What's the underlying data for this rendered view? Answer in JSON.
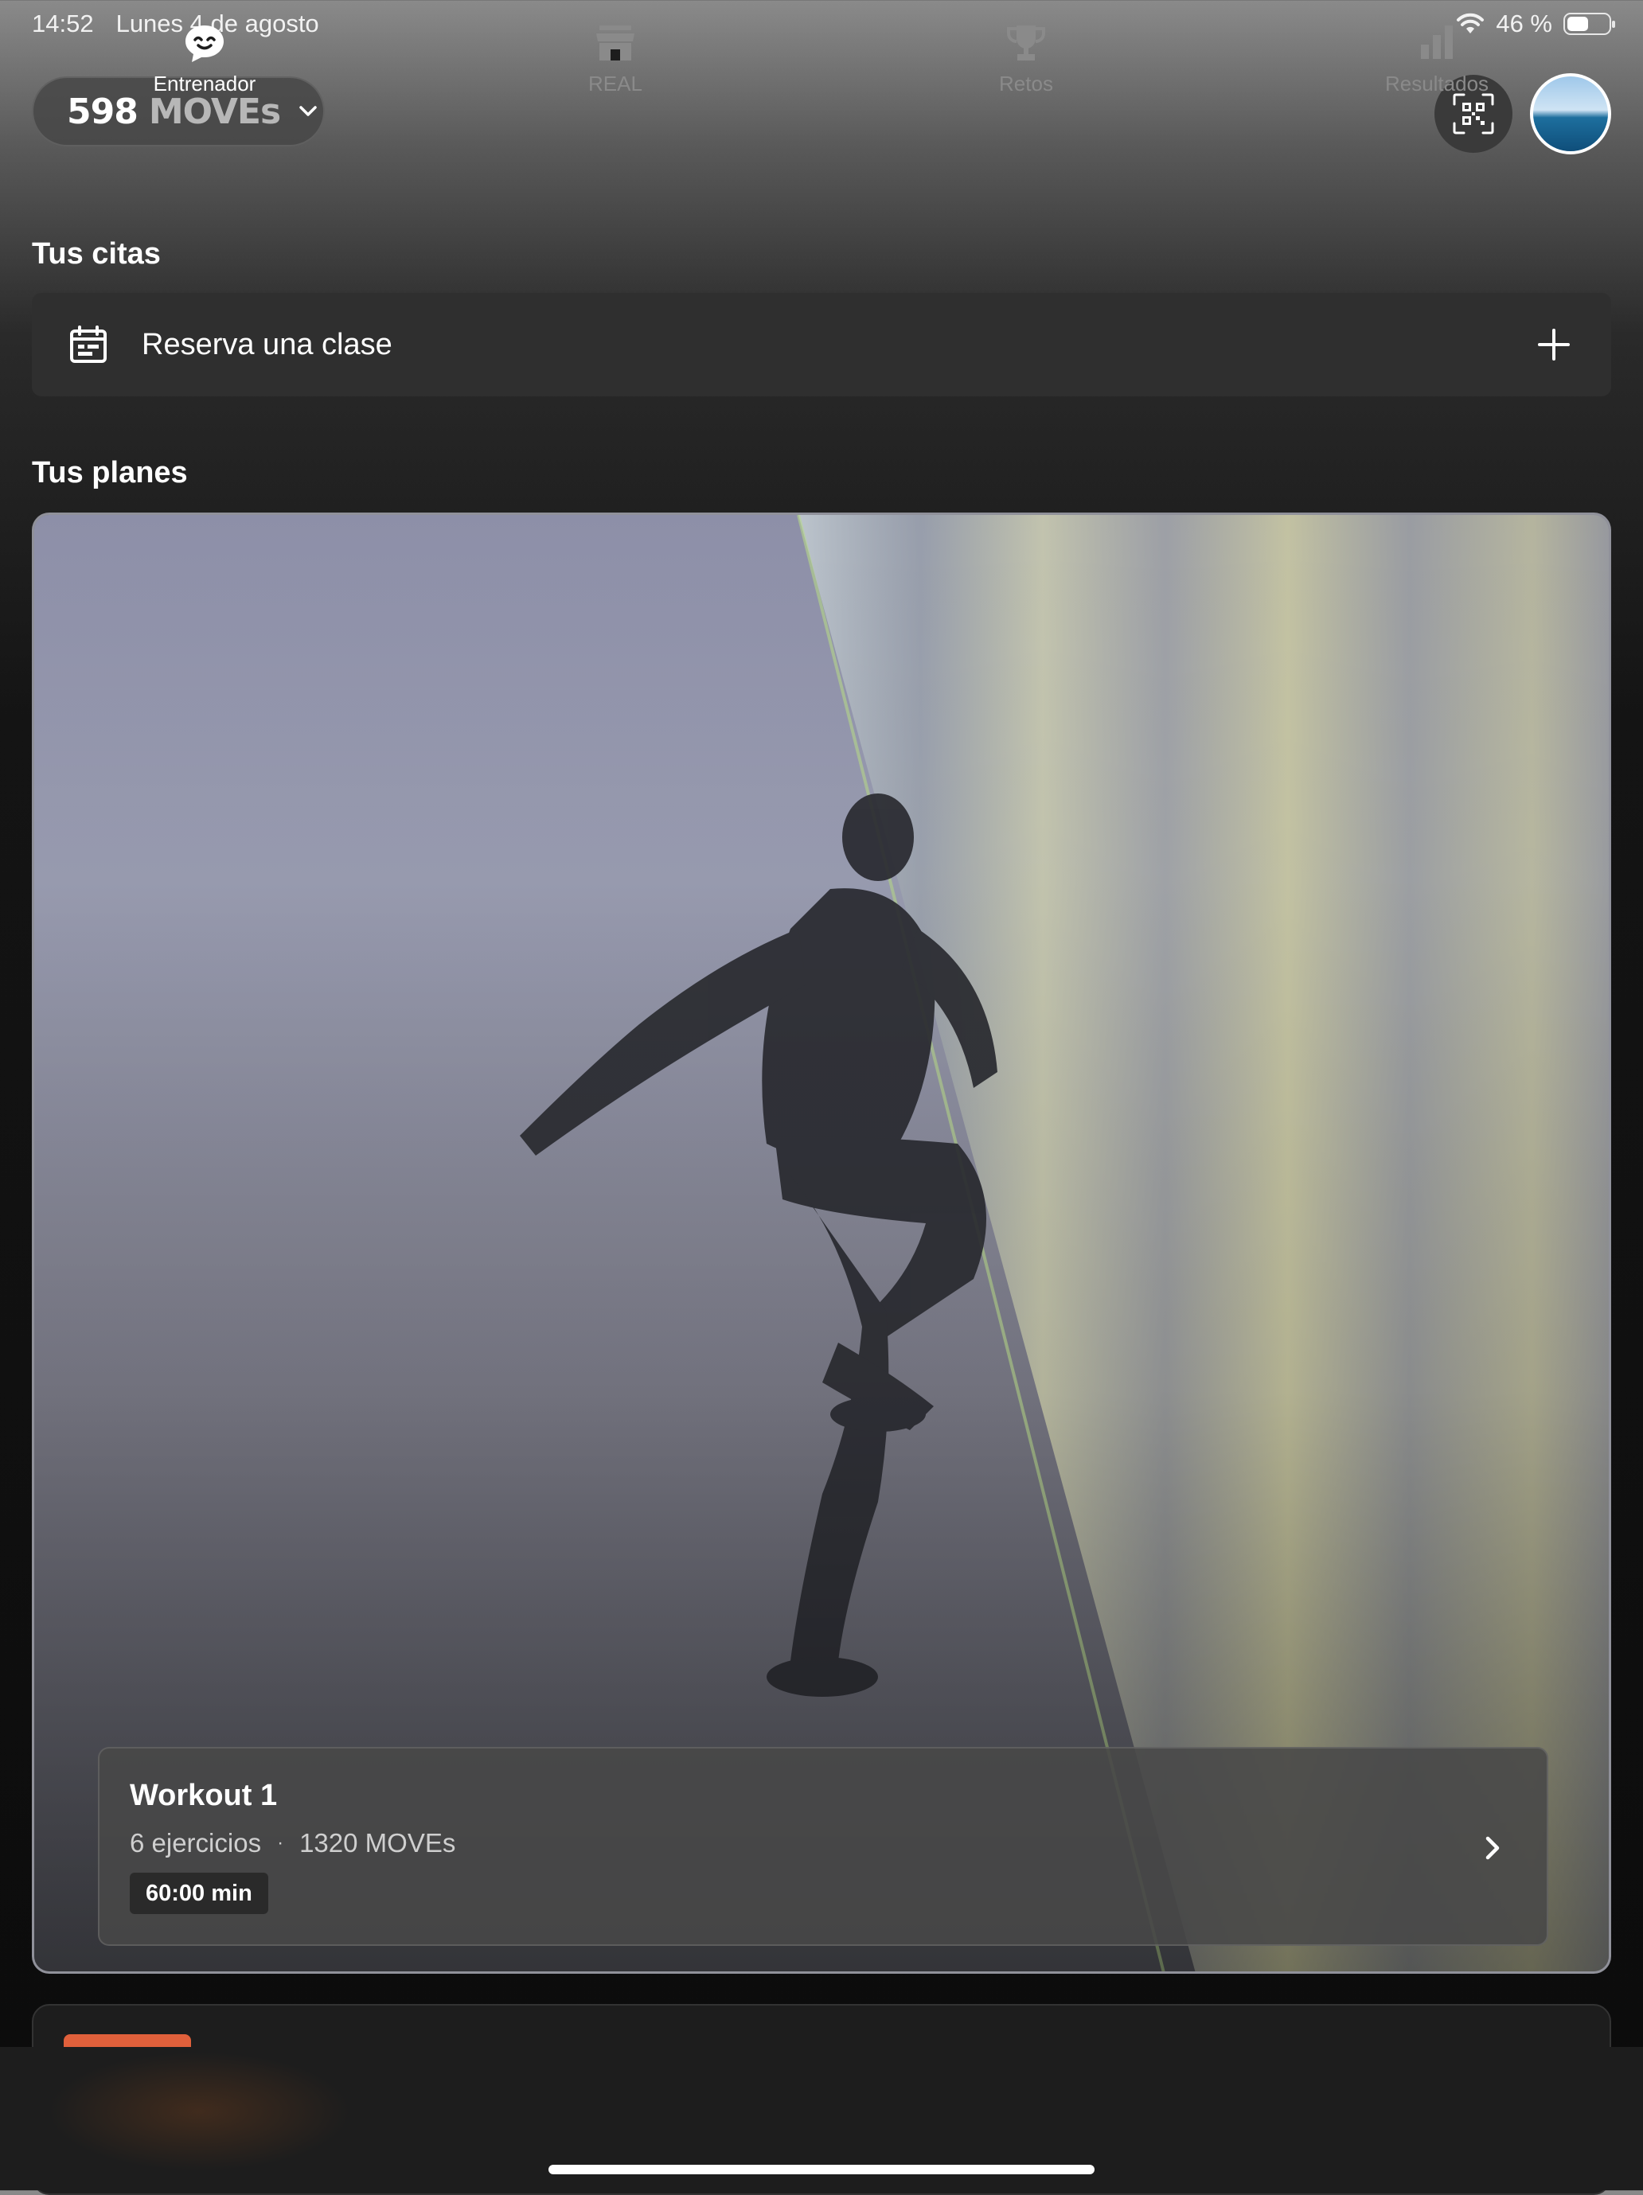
{
  "status_bar": {
    "time": "14:52",
    "date": "Lunes 4 de agosto",
    "battery_text": "46 %",
    "battery_level": 0.46,
    "icons": [
      "wifi-icon",
      "battery-icon"
    ]
  },
  "header": {
    "moves_count": "598",
    "moves_unit": "MOVEs",
    "icons": [
      "chevron-down-icon",
      "qr-code-icon",
      "avatar"
    ]
  },
  "appointments": {
    "title": "Tus citas",
    "reserve_label": "Reserva una clase",
    "icons": [
      "calendar-icon",
      "plus-icon"
    ]
  },
  "plans": {
    "title": "Tus planes",
    "card": {
      "name": "Workout 1",
      "exercises": "6 ejercicios",
      "separator": "·",
      "moves": "1320 MOVEs",
      "duration": "60:00 min",
      "icons": [
        "chevron-right-icon"
      ]
    }
  },
  "tabs": [
    {
      "label": "Entrenador",
      "icon": "coach-chat-icon",
      "active": true
    },
    {
      "label": "REAL",
      "icon": "store-icon",
      "active": false
    },
    {
      "label": "Retos",
      "icon": "trophy-icon",
      "active": false
    },
    {
      "label": "Resultados",
      "icon": "bar-chart-icon",
      "active": false
    }
  ],
  "colors": {
    "accent": "#e0603b",
    "card_bg": "#2f2f2f",
    "tabbar_bg": "#1d1d1d"
  }
}
